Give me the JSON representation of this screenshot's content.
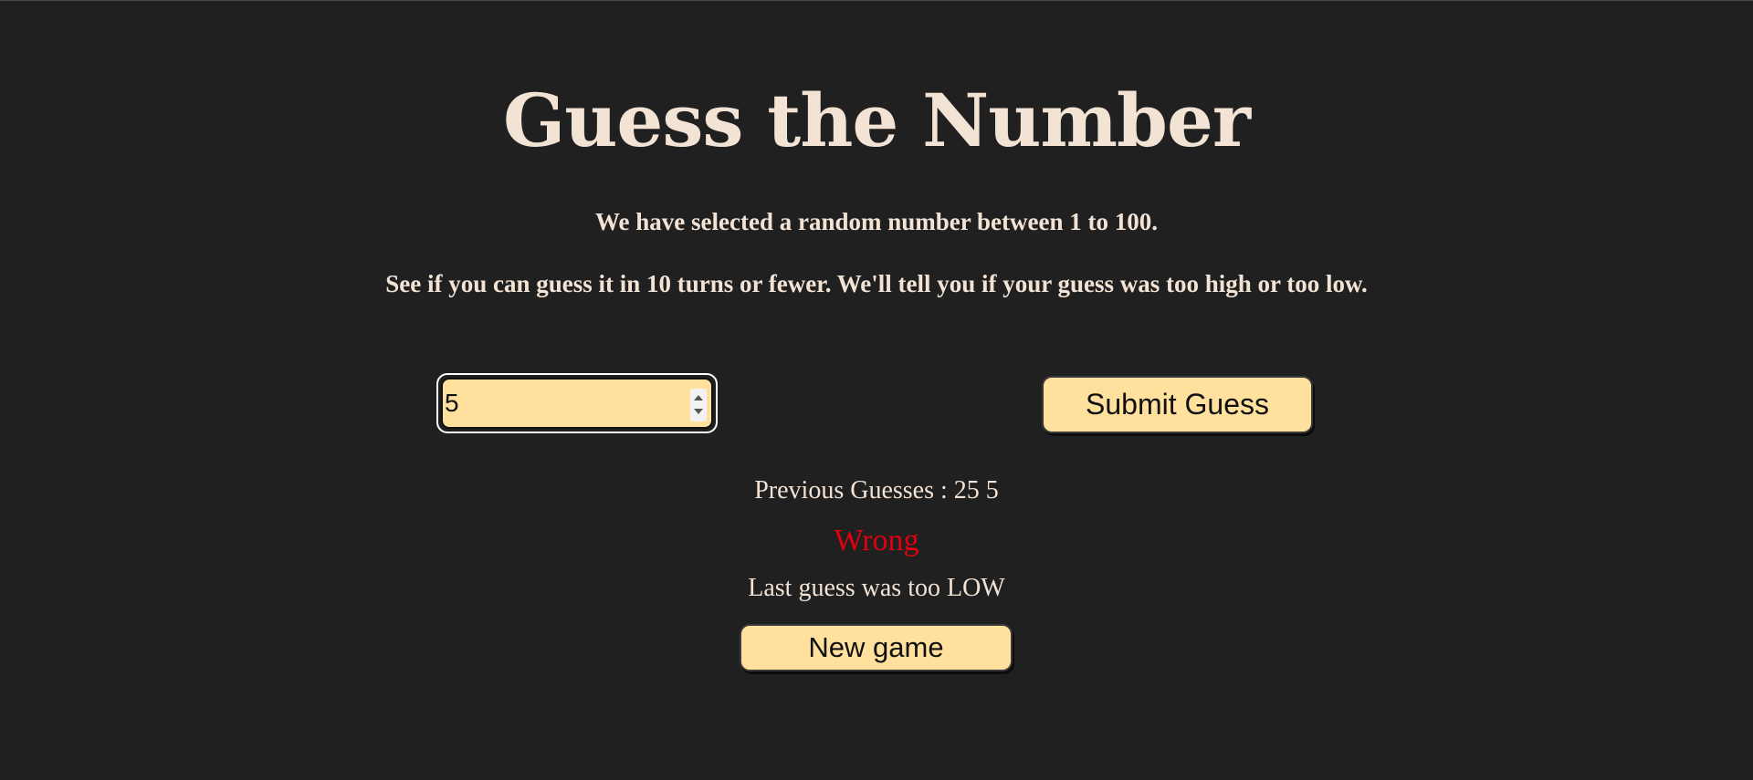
{
  "page": {
    "title": "Guess the Number",
    "intro_line_1": "We have selected a random number between 1 to 100.",
    "intro_line_2": "See if you can guess it in 10 turns or fewer. We'll tell you if your guess was too high or too low."
  },
  "form": {
    "guess_value": "5",
    "submit_label": "Submit Guess"
  },
  "results": {
    "previous_guesses": "Previous Guesses : 25 5",
    "last_result": "Wrong",
    "low_or_high": "Last guess was too LOW"
  },
  "controls": {
    "new_game_label": "New game"
  },
  "colors": {
    "background": "#202020",
    "text": "#f2e3d5",
    "button": "#ffe09c",
    "wrong": "#e0000e"
  }
}
